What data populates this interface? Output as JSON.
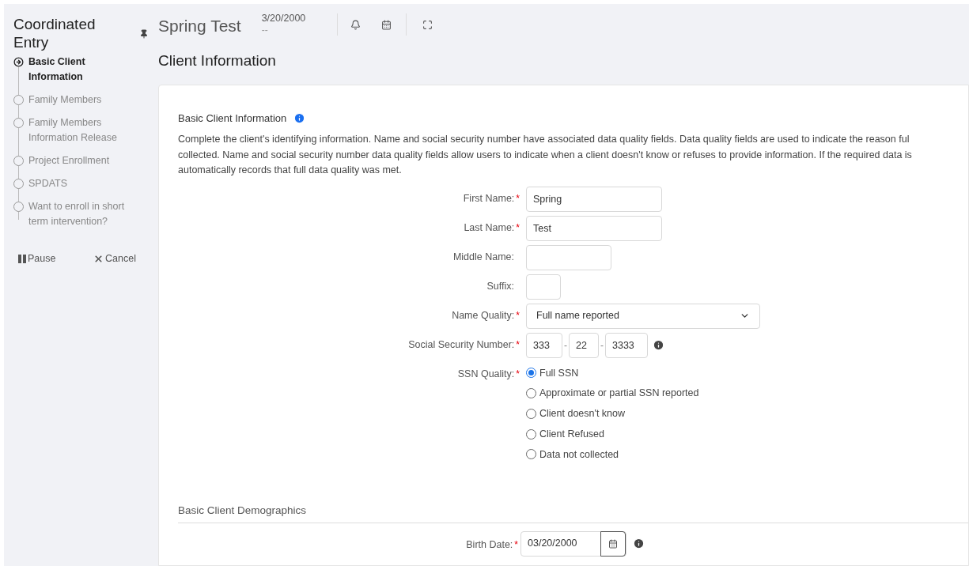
{
  "sidebar": {
    "title": "Coordinated Entry",
    "steps": [
      {
        "label": "Basic Client Information",
        "selected": true
      },
      {
        "label": "Family Members",
        "selected": false
      },
      {
        "label": "Family Members Information Release",
        "selected": false
      },
      {
        "label": "Project Enrollment",
        "selected": false
      },
      {
        "label": "SPDATS",
        "selected": false
      },
      {
        "label": "Want to enroll in short term intervention?",
        "selected": false
      }
    ],
    "actions": [
      {
        "kind": "pause",
        "label": "Pause"
      },
      {
        "kind": "cancel",
        "label": "Cancel"
      }
    ]
  },
  "header": {
    "client_name": "Spring Test",
    "date": "3/20/2000",
    "date_sub": "--"
  },
  "page_title": "Client Information",
  "section": {
    "title": "Basic Client Information",
    "description_lines": [
      "Complete the client's identifying information. Name and social security number have associated data quality fields. Data quality fields are used to indicate the reason ful",
      "collected. Name and social security number data quality fields allow users to indicate when a client doesn't know or refuses to provide information. If the required data is",
      "automatically records that full data quality was met."
    ],
    "fields": [
      {
        "kind": "text",
        "label": "First Name:",
        "required_mark": "*",
        "value": "Spring"
      },
      {
        "kind": "text",
        "label": "Last Name:",
        "required_mark": "*",
        "value": "Test"
      },
      {
        "kind": "shorttext",
        "label": "Middle Name:"
      },
      {
        "kind": "tinytext",
        "label": "Suffix:"
      },
      {
        "kind": "select",
        "label": "Name Quality:",
        "required_mark": "*",
        "value": "Full name reported"
      },
      {
        "kind": "ssn",
        "label": "Social Security Number:",
        "required_mark": "*",
        "parts": [
          "333",
          "22",
          "3333"
        ],
        "separator": "-"
      },
      {
        "kind": "radio",
        "label": "SSN Quality:",
        "required_mark": "*",
        "options": [
          {
            "label": "Full SSN",
            "selected": true
          },
          {
            "label": "Approximate or partial SSN reported",
            "selected": false
          },
          {
            "label": "Client doesn't know",
            "selected": false
          },
          {
            "label": "Client Refused",
            "selected": false
          },
          {
            "label": "Data not collected",
            "selected": false
          }
        ]
      }
    ]
  },
  "demographics": {
    "title": "Basic Client Demographics",
    "birth_date": {
      "label": "Birth Date:",
      "required_mark": "*",
      "value": "03/20/2000"
    }
  }
}
